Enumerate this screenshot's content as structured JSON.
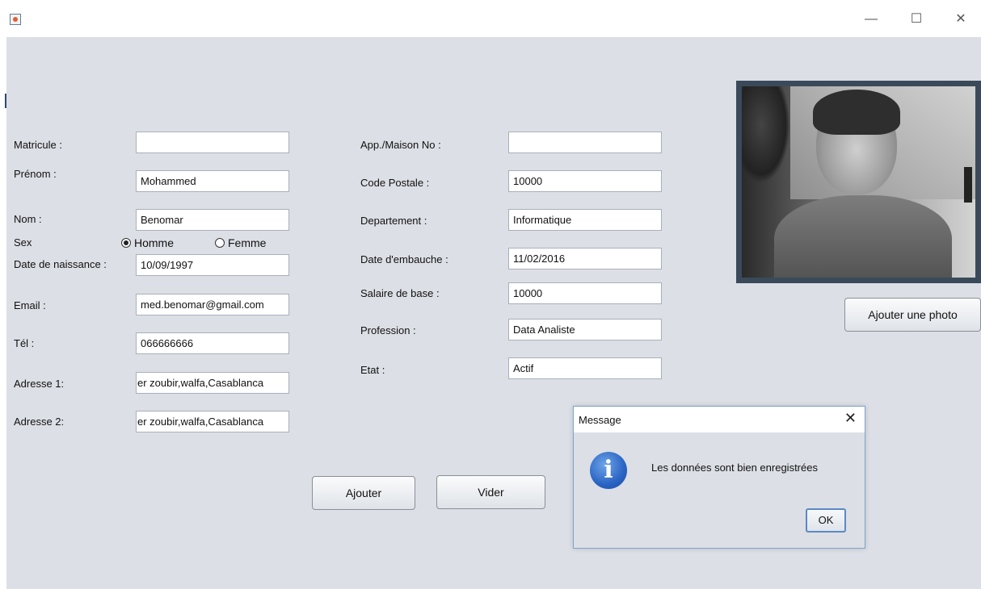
{
  "window": {
    "app_icon": "java-icon",
    "controls": {
      "minimize": "—",
      "maximize": "☐",
      "close": "✕"
    }
  },
  "form_left": {
    "matricule": {
      "label": "Matricule :",
      "value": ""
    },
    "prenom": {
      "label": "Prénom :",
      "value": "Mohammed"
    },
    "nom": {
      "label": "Nom :",
      "value": "Benomar"
    },
    "sex": {
      "label": "Sex",
      "options": [
        "Homme",
        "Femme"
      ],
      "selected": "Homme"
    },
    "date_naissance": {
      "label": "Date de naissance :",
      "value": "10/09/1997"
    },
    "email": {
      "label": "Email :",
      "value": "med.benomar@gmail.com"
    },
    "tel": {
      "label": "Tél :",
      "value": "066666666"
    },
    "adresse1": {
      "label": "Adresse 1:",
      "value": "er zoubir,walfa,Casablanca"
    },
    "adresse2": {
      "label": "Adresse 2:",
      "value": "er zoubir,walfa,Casablanca"
    }
  },
  "form_right": {
    "app_maison": {
      "label": "App./Maison No :",
      "value": ""
    },
    "code_postale": {
      "label": "Code Postale :",
      "value": "10000"
    },
    "departement": {
      "label": "Departement :",
      "value": "Informatique"
    },
    "date_embauche": {
      "label": "Date d'embauche :",
      "value": "11/02/2016"
    },
    "salaire": {
      "label": "Salaire de base :",
      "value": "10000"
    },
    "profession": {
      "label": "Profession :",
      "value": "Data Analiste"
    },
    "etat": {
      "label": "Etat :",
      "value": "Actif"
    }
  },
  "buttons": {
    "ajouter": "Ajouter",
    "vider": "Vider",
    "ajouter_photo": "Ajouter une photo"
  },
  "dialog": {
    "title": "Message",
    "close": "✕",
    "icon": "info-icon",
    "icon_glyph": "i",
    "message": "Les données sont bien enregistrées",
    "ok": "OK"
  }
}
